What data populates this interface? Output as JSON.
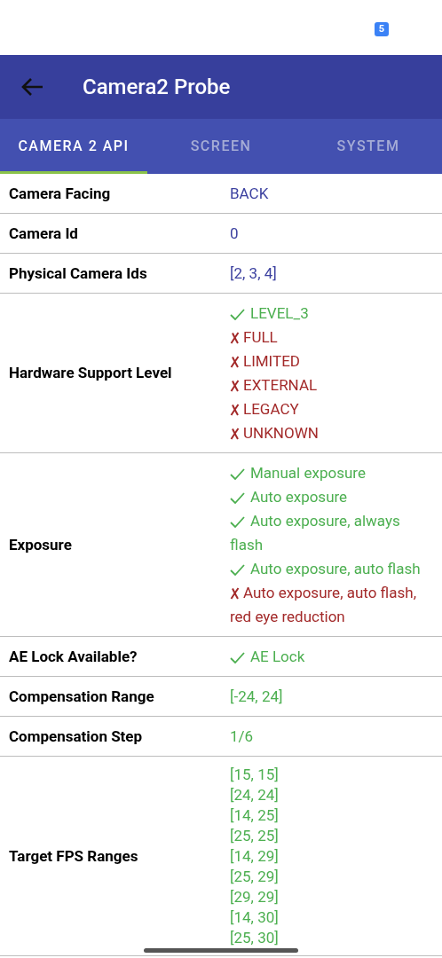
{
  "status_bar": {
    "notification_count": "5"
  },
  "toolbar": {
    "title": "Camera2 Probe"
  },
  "tabs": [
    {
      "label": "CAMERA 2 API",
      "selected": true
    },
    {
      "label": "SCREEN",
      "selected": false
    },
    {
      "label": "SYSTEM",
      "selected": false
    }
  ],
  "rows": [
    {
      "label": "Camera Facing",
      "values": [
        {
          "kind": "plain",
          "text": "BACK"
        }
      ]
    },
    {
      "label": "Camera Id",
      "values": [
        {
          "kind": "plain",
          "text": "0"
        }
      ]
    },
    {
      "label": "Physical Camera Ids",
      "values": [
        {
          "kind": "plain",
          "text": "[2, 3, 4]"
        }
      ]
    },
    {
      "label": "Hardware Support Level",
      "values": [
        {
          "kind": "supported",
          "text": "LEVEL_3"
        },
        {
          "kind": "unsupported",
          "text": "FULL"
        },
        {
          "kind": "unsupported",
          "text": "LIMITED"
        },
        {
          "kind": "unsupported",
          "text": "EXTERNAL"
        },
        {
          "kind": "unsupported",
          "text": "LEGACY"
        },
        {
          "kind": "unsupported",
          "text": "UNKNOWN"
        }
      ]
    },
    {
      "label": "Exposure",
      "values": [
        {
          "kind": "supported",
          "text": "Manual exposure"
        },
        {
          "kind": "supported",
          "text": "Auto exposure"
        },
        {
          "kind": "supported",
          "text": "Auto exposure, always flash"
        },
        {
          "kind": "supported",
          "text": "Auto exposure, auto flash"
        },
        {
          "kind": "unsupported",
          "text": "Auto exposure, auto flash, red eye reduction"
        }
      ]
    },
    {
      "label": "AE Lock Available?",
      "values": [
        {
          "kind": "supported",
          "text": "AE Lock"
        }
      ]
    },
    {
      "label": "Compensation Range",
      "values": [
        {
          "kind": "number",
          "text": "[-24, 24]"
        }
      ]
    },
    {
      "label": "Compensation Step",
      "values": [
        {
          "kind": "number",
          "text": "1/6"
        }
      ]
    },
    {
      "label": "Target FPS Ranges",
      "values": [
        {
          "kind": "number",
          "text": "[15, 15]"
        },
        {
          "kind": "number",
          "text": "[24, 24]"
        },
        {
          "kind": "number",
          "text": "[14, 25]"
        },
        {
          "kind": "number",
          "text": "[25, 25]"
        },
        {
          "kind": "number",
          "text": "[14, 29]"
        },
        {
          "kind": "number",
          "text": "[25, 29]"
        },
        {
          "kind": "number",
          "text": "[29, 29]"
        },
        {
          "kind": "number",
          "text": "[14, 30]"
        },
        {
          "kind": "number",
          "text": "[25, 30]"
        }
      ]
    }
  ]
}
